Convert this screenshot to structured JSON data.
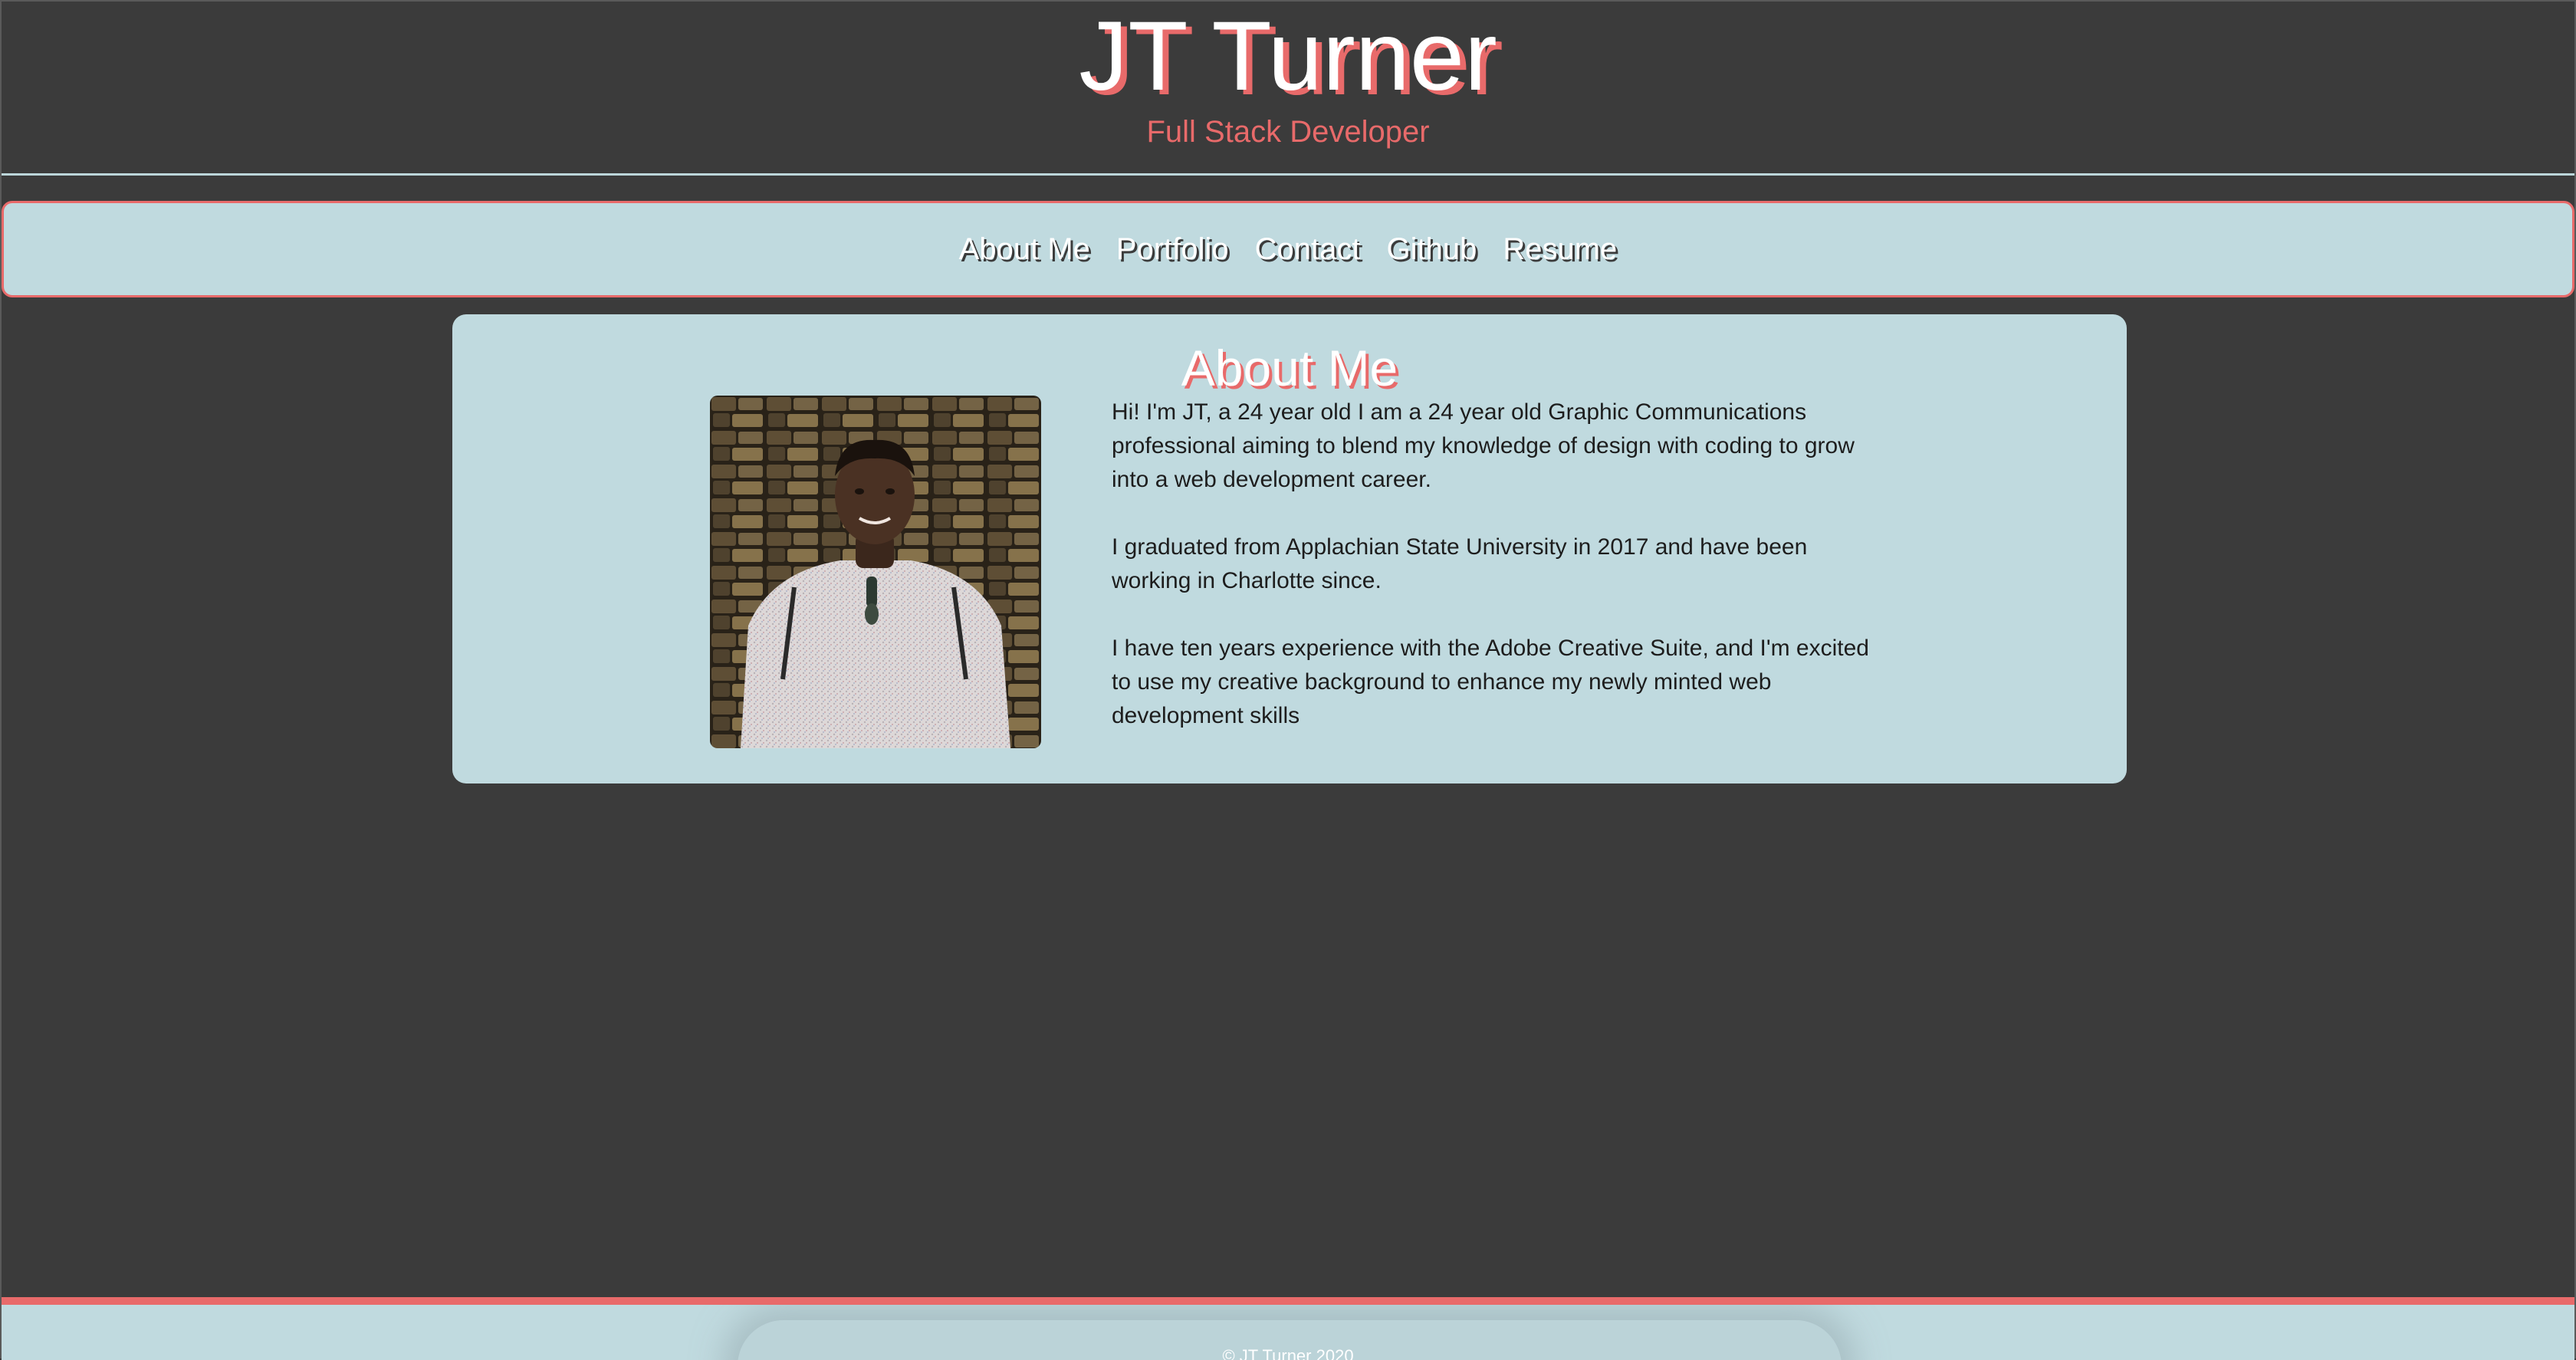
{
  "header": {
    "title": "JT Turner",
    "subtitle": "Full Stack Developer"
  },
  "nav": {
    "items": [
      {
        "label": "About Me"
      },
      {
        "label": "Portfolio"
      },
      {
        "label": "Contact"
      },
      {
        "label": "Github"
      },
      {
        "label": "Resume"
      }
    ]
  },
  "about": {
    "heading": "About Me",
    "photo_icon": "profile-photo",
    "paragraphs": [
      "Hi! I'm JT, a 24 year old I am a 24 year old Graphic Communications professional aiming to blend my knowledge of design with coding to grow into a web development career.",
      "I graduated from Applachian State University in 2017 and have been working in Charlotte since.",
      "I have ten years experience with the Adobe Creative Suite, and I'm excited to use my creative background to enhance my newly minted web development skills"
    ]
  },
  "footer": {
    "copyright": "©  JT Turner 2020"
  },
  "colors": {
    "background": "#3b3b3b",
    "panel": "#c0dadf",
    "accent": "#e86a6a",
    "text": "#1d1d1d"
  }
}
